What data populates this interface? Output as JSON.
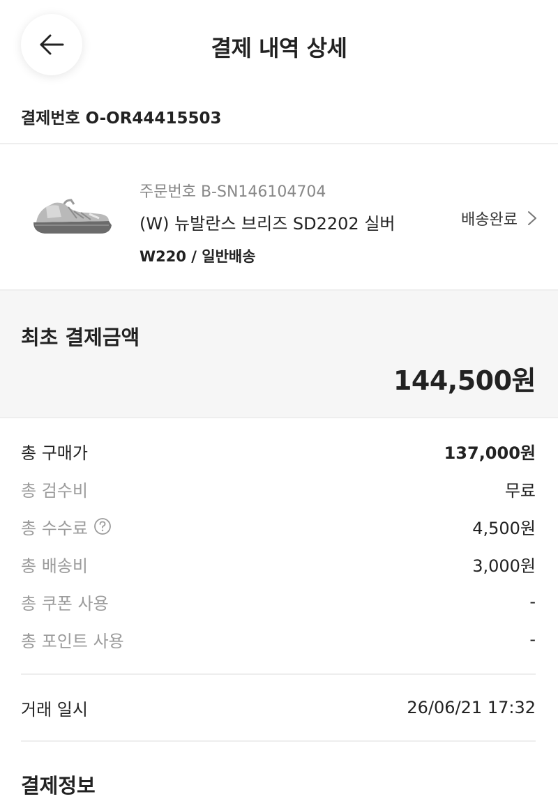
{
  "header": {
    "title": "결제 내역 상세",
    "back_icon": "arrow-left-icon"
  },
  "payment": {
    "label": "결제번호",
    "number": "O-OR44415503"
  },
  "product": {
    "order_number": "주문번호 B-SN146104704",
    "name": "(W) 뉴발란스 브리즈 SD2202 실버",
    "option": "W220 / 일반배송",
    "status": "배송완료",
    "image_icon": "sneaker-product-image"
  },
  "total": {
    "label": "최초 결제금액",
    "value": "144,500원"
  },
  "breakdown": [
    {
      "label": "총 구매가",
      "value": "137,000원"
    },
    {
      "label": "총 검수비",
      "value": "무료"
    },
    {
      "label": "총 수수료",
      "value": "4,500원",
      "help_icon": "question-circle-icon"
    },
    {
      "label": "총 배송비",
      "value": "3,000원"
    },
    {
      "label": "총 쿠폰 사용",
      "value": "-"
    },
    {
      "label": "총 포인트 사용",
      "value": "-"
    }
  ],
  "transaction": {
    "label": "거래 일시",
    "value": "26/06/21 17:32"
  },
  "payment_info": {
    "title": "결제정보"
  },
  "colors": {
    "text_primary": "#222222",
    "text_secondary": "#9b9b9b",
    "summary_bg": "#f6f6f6",
    "divider": "#eeeeee"
  }
}
